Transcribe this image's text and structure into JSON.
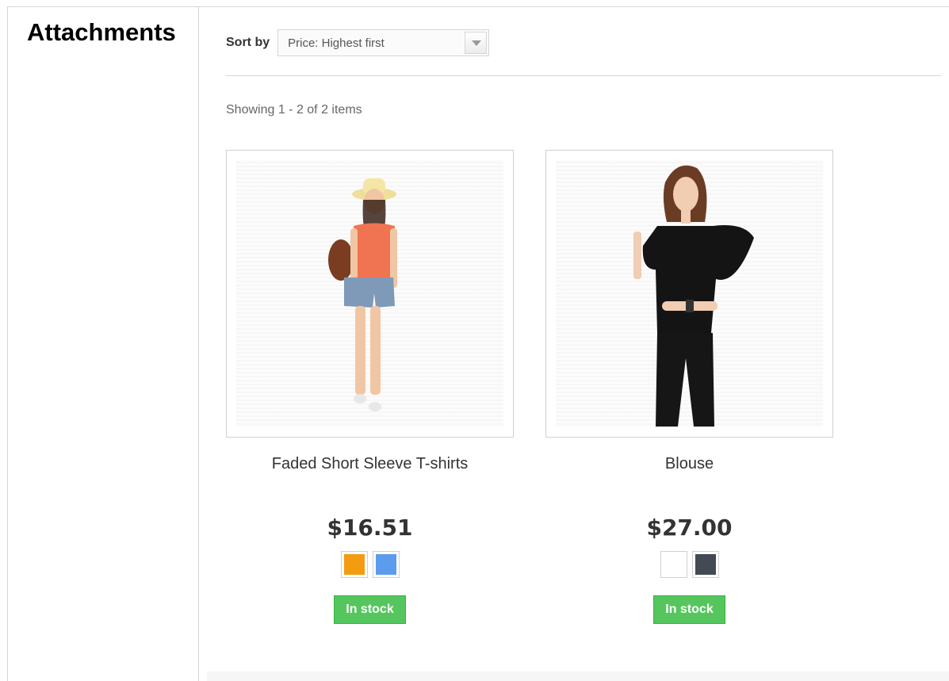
{
  "sidebar": {
    "title": "Attachments"
  },
  "sort": {
    "label": "Sort by",
    "selected": "Price: Highest first"
  },
  "listing": {
    "summary": "Showing 1 - 2 of 2 items"
  },
  "products": [
    {
      "name": "Faded Short Sleeve T-shirts",
      "price": "$16.51",
      "colors": [
        "#f39c11",
        "#5d9cec"
      ],
      "stock": "In stock"
    },
    {
      "name": "Blouse",
      "price": "$27.00",
      "colors": [
        "#ffffff",
        "#434a54"
      ],
      "stock": "In stock"
    }
  ],
  "theme": {
    "stock_green": "#55c65e",
    "border": "#d6d6d6"
  }
}
